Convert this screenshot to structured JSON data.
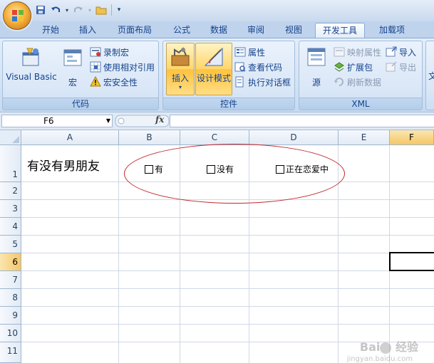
{
  "quick_access": [
    "save-icon",
    "undo-icon",
    "redo-icon",
    "open-folder-icon"
  ],
  "tabs": [
    {
      "label": "开始",
      "active": false
    },
    {
      "label": "插入",
      "active": false
    },
    {
      "label": "页面布局",
      "active": false
    },
    {
      "label": "公式",
      "active": false
    },
    {
      "label": "数据",
      "active": false
    },
    {
      "label": "审阅",
      "active": false
    },
    {
      "label": "视图",
      "active": false
    },
    {
      "label": "开发工具",
      "active": true
    },
    {
      "label": "加载项",
      "active": false
    }
  ],
  "ribbon": {
    "code": {
      "title": "代码",
      "visual_basic": "Visual Basic",
      "macros": "宏",
      "record_macro": "录制宏",
      "relative_ref": "使用相对引用",
      "macro_security": "宏安全性"
    },
    "controls": {
      "title": "控件",
      "insert": "插入",
      "design_mode": "设计模式",
      "properties": "属性",
      "view_code": "查看代码",
      "run_dialog": "执行对话框"
    },
    "xml": {
      "title": "XML",
      "source": "源",
      "map_properties": "映射属性",
      "expansion_packs": "扩展包",
      "refresh_data": "刷新数据",
      "import": "导入",
      "export": "导出"
    },
    "cut_label": "文"
  },
  "formula_bar": {
    "name_box": "F6",
    "fx_label": "fx",
    "value": ""
  },
  "columns": [
    "A",
    "B",
    "C",
    "D",
    "E",
    "F"
  ],
  "selected_column": "F",
  "rows": [
    "1",
    "2",
    "3",
    "4",
    "5",
    "6",
    "7",
    "8",
    "9",
    "10",
    "11"
  ],
  "selected_row": "6",
  "cells": {
    "A1": "有没有男朋友"
  },
  "checkboxes": [
    {
      "label": "有",
      "checked": false
    },
    {
      "label": "没有",
      "checked": false
    },
    {
      "label": "正在恋爱中",
      "checked": false
    }
  ],
  "colors": {
    "annotation_ellipse": "#c0282d",
    "active_tab": "#ffffff",
    "ribbon_bg": "#d4e3f5"
  },
  "watermark": {
    "brand": "Bai",
    "brand2": "经验",
    "site": "jingyan.baidu.com"
  }
}
